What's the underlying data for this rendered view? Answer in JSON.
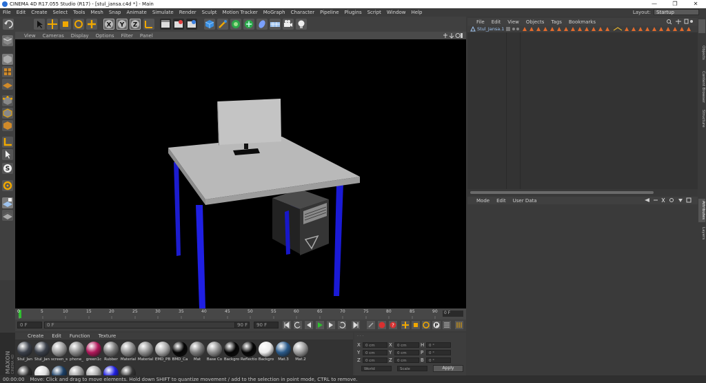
{
  "window": {
    "title": "CINEMA 4D R17.055 Studio (R17) - [stul_jansa.c4d *] - Main",
    "controls": [
      "—",
      "❐",
      "✕"
    ]
  },
  "menubar": {
    "items": [
      "File",
      "Edit",
      "Create",
      "Select",
      "Tools",
      "Mesh",
      "Snap",
      "Animate",
      "Simulate",
      "Render",
      "Sculpt",
      "Motion Tracker",
      "MoGraph",
      "Character",
      "Pipeline",
      "Plugins",
      "Script",
      "Window",
      "Help"
    ],
    "layout_label": "Layout:",
    "layout_value": "Startup"
  },
  "viewport": {
    "menu": [
      "View",
      "Cameras",
      "Display",
      "Options",
      "Filter",
      "Panel"
    ]
  },
  "timeline": {
    "ticks": [
      "0",
      "5",
      "10",
      "15",
      "20",
      "25",
      "30",
      "35",
      "40",
      "45",
      "50",
      "55",
      "60",
      "65",
      "70",
      "75",
      "80",
      "85",
      "90"
    ],
    "frame_badge": "0 F",
    "start_field": "0 F",
    "current_field": "0 F",
    "end_field": "90 F",
    "max_field": "90 F"
  },
  "materials": {
    "menu": [
      "Create",
      "Edit",
      "Function",
      "Texture"
    ],
    "items": [
      {
        "name": "Stul_Jan",
        "color": "#3a3f49"
      },
      {
        "name": "Stul_Jan",
        "color": "#3a3f49"
      },
      {
        "name": "screen_s",
        "color": "#9a9a9a"
      },
      {
        "name": "phone_",
        "color": "#8a8a8a"
      },
      {
        "name": "green1c",
        "color": "#b0185a"
      },
      {
        "name": "Rubber",
        "color": "#777777"
      },
      {
        "name": "Material",
        "color": "#8e8e8e"
      },
      {
        "name": "Material",
        "color": "#8e8e8e"
      },
      {
        "name": "EMD_PB",
        "color": "#a5a5a5"
      },
      {
        "name": "BMD_Ca",
        "color": "#050505"
      },
      {
        "name": "Mat",
        "color": "#7a7a7a"
      },
      {
        "name": "Base Co",
        "color": "#8a8a8a"
      },
      {
        "name": "Backgro",
        "color": "#050505"
      },
      {
        "name": "Reflectio",
        "color": "#050505"
      },
      {
        "name": "Backgro",
        "color": "#ececec"
      },
      {
        "name": "Mat.3",
        "color": "#2a5a8a"
      },
      {
        "name": "Mat.2",
        "color": "#9a9a9a"
      }
    ]
  },
  "coords": {
    "rows": [
      {
        "a": "X",
        "av": "0 cm",
        "b": "X",
        "bv": "0 cm",
        "c": "H",
        "cv": "0 °"
      },
      {
        "a": "Y",
        "av": "0 cm",
        "b": "Y",
        "bv": "0 cm",
        "c": "P",
        "cv": "0 °"
      },
      {
        "a": "Z",
        "av": "0 cm",
        "b": "Z",
        "bv": "0 cm",
        "c": "B",
        "cv": "0 °"
      }
    ],
    "world": "World",
    "scale": "Scale",
    "apply": "Apply"
  },
  "status": {
    "time": "00:00:00",
    "message": "Move: Click and drag to move elements. Hold down SHIFT to quantize movement / add to the selection in point mode, CTRL to remove."
  },
  "object_manager": {
    "menu": [
      "File",
      "Edit",
      "View",
      "Objects",
      "Tags",
      "Bookmarks"
    ],
    "object_name": "Stul_Jansa.1"
  },
  "attribute_manager": {
    "menu": [
      "Mode",
      "Edit",
      "User Data"
    ]
  },
  "right_tabs": [
    "Objects",
    "Content Browser",
    "Structure",
    "Attributes",
    "Layers"
  ],
  "colors": {
    "accent_blue": "#1e1ee0",
    "tag_orange": "#e06a2c"
  }
}
